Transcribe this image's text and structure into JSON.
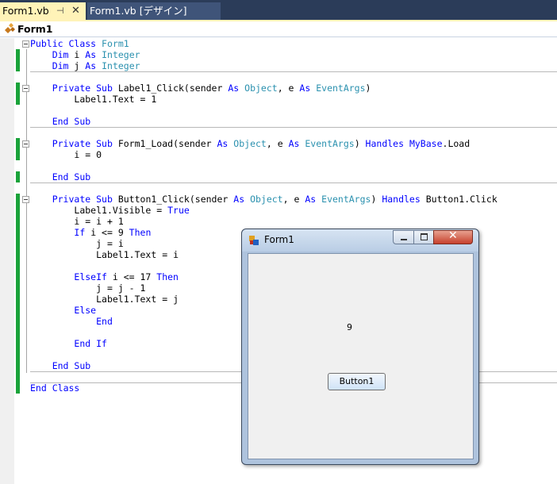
{
  "tabs": [
    {
      "label": "Form1.vb",
      "active": true
    },
    {
      "label": "Form1.vb [デザイン]",
      "active": false
    }
  ],
  "navbar": {
    "label": "Form1"
  },
  "colors": {
    "keyword": "#0000ff",
    "type": "#2b91af",
    "tab_active": "#fff3b8",
    "tab_bar": "#2b3c59"
  },
  "code": {
    "lines": [
      "Public Class Form1",
      "    Dim i As Integer",
      "    Dim j As Integer",
      "",
      "    Private Sub Label1_Click(sender As Object, e As EventArgs)",
      "        Label1.Text = 1",
      "",
      "    End Sub",
      "",
      "    Private Sub Form1_Load(sender As Object, e As EventArgs) Handles MyBase.Load",
      "        i = 0",
      "",
      "    End Sub",
      "",
      "    Private Sub Button1_Click(sender As Object, e As EventArgs) Handles Button1.Click",
      "        Label1.Visible = True",
      "        i = i + 1",
      "        If i <= 9 Then",
      "            j = i",
      "            Label1.Text = i",
      "",
      "        ElseIf i <= 17 Then",
      "            j = j - 1",
      "            Label1.Text = j",
      "        Else",
      "            End",
      "",
      "        End If",
      "",
      "    End Sub",
      "",
      "End Class"
    ],
    "keywords": [
      "Public",
      "Class",
      "Dim",
      "As",
      "Private",
      "Sub",
      "End",
      "Handles",
      "MyBase",
      "If",
      "Then",
      "ElseIf",
      "Else",
      "True"
    ],
    "types": [
      "Form1",
      "Integer",
      "Object",
      "EventArgs"
    ]
  },
  "form_window": {
    "title": "Form1",
    "label_value": "9",
    "button_label": "Button1",
    "close_glyph": "✕"
  },
  "icons": {
    "tab_pin": "pin-icon",
    "tab_close": "close-icon",
    "navbar": "class-icon",
    "window": "form-icon"
  }
}
